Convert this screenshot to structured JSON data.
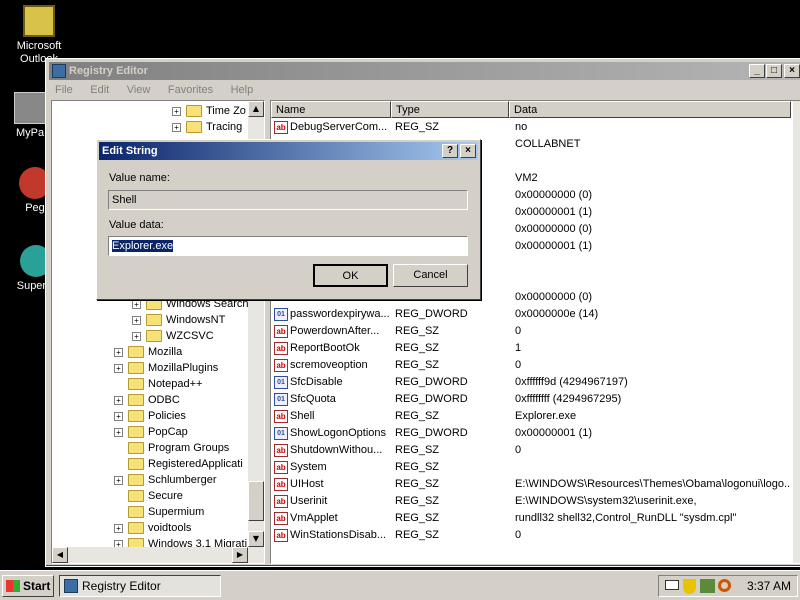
{
  "desktop": {
    "icons": [
      {
        "label": "Microsoft Outlook"
      },
      {
        "label": "MyPa"
      },
      {
        "label": "Peg"
      },
      {
        "label": "Superm"
      }
    ]
  },
  "window": {
    "title": "Registry Editor",
    "menu": [
      "File",
      "Edit",
      "View",
      "Favorites",
      "Help"
    ]
  },
  "tree": {
    "items": [
      {
        "label": "Time Zo",
        "expander": "+"
      },
      {
        "label": "Tracing",
        "expander": "+"
      },
      {
        "label": "Windows Search",
        "expander": "+"
      },
      {
        "label": "WindowsNT",
        "expander": "+"
      },
      {
        "label": "WZCSVC",
        "expander": "+"
      },
      {
        "label": "Mozilla",
        "expander": "+"
      },
      {
        "label": "MozillaPlugins",
        "expander": "+"
      },
      {
        "label": "Notepad++",
        "expander": ""
      },
      {
        "label": "ODBC",
        "expander": "+"
      },
      {
        "label": "Policies",
        "expander": "+"
      },
      {
        "label": "PopCap",
        "expander": "+"
      },
      {
        "label": "Program Groups",
        "expander": ""
      },
      {
        "label": "RegisteredApplicati",
        "expander": ""
      },
      {
        "label": "Schlumberger",
        "expander": "+"
      },
      {
        "label": "Secure",
        "expander": ""
      },
      {
        "label": "Supermium",
        "expander": ""
      },
      {
        "label": "voidtools",
        "expander": "+"
      },
      {
        "label": "Windows 3.1 Migrati",
        "expander": "+"
      }
    ]
  },
  "list": {
    "columns": [
      "Name",
      "Type",
      "Data"
    ],
    "top_rows": [
      {
        "name": "DebugServerCom...",
        "type": "REG_SZ",
        "data": "no",
        "icon": "string"
      },
      {
        "name": "",
        "type": "",
        "data": "COLLABNET",
        "icon": ""
      },
      {
        "name": "",
        "type": "",
        "data": "",
        "icon": ""
      },
      {
        "name": "",
        "type": "",
        "data": "VM2",
        "icon": ""
      },
      {
        "name": "",
        "type": "",
        "data": "0x00000000 (0)",
        "icon": ""
      },
      {
        "name": "",
        "type": "",
        "data": "0x00000001 (1)",
        "icon": ""
      },
      {
        "name": "",
        "type": "",
        "data": "0x00000000 (0)",
        "icon": ""
      },
      {
        "name": "",
        "type": "",
        "data": "0x00000001 (1)",
        "icon": ""
      },
      {
        "name": "",
        "type": "",
        "data": "",
        "icon": ""
      },
      {
        "name": "",
        "type": "",
        "data": "",
        "icon": ""
      },
      {
        "name": "",
        "type": "",
        "data": "0x00000000 (0)",
        "icon": ""
      }
    ],
    "rows": [
      {
        "name": "passwordexpirywa...",
        "type": "REG_DWORD",
        "data": "0x0000000e (14)",
        "icon": "binary"
      },
      {
        "name": "PowerdownAfter...",
        "type": "REG_SZ",
        "data": "0",
        "icon": "string"
      },
      {
        "name": "ReportBootOk",
        "type": "REG_SZ",
        "data": "1",
        "icon": "string"
      },
      {
        "name": "scremoveoption",
        "type": "REG_SZ",
        "data": "0",
        "icon": "string"
      },
      {
        "name": "SfcDisable",
        "type": "REG_DWORD",
        "data": "0xffffff9d (4294967197)",
        "icon": "binary"
      },
      {
        "name": "SfcQuota",
        "type": "REG_DWORD",
        "data": "0xffffffff (4294967295)",
        "icon": "binary"
      },
      {
        "name": "Shell",
        "type": "REG_SZ",
        "data": "Explorer.exe",
        "icon": "string"
      },
      {
        "name": "ShowLogonOptions",
        "type": "REG_DWORD",
        "data": "0x00000001 (1)",
        "icon": "binary"
      },
      {
        "name": "ShutdownWithou...",
        "type": "REG_SZ",
        "data": "0",
        "icon": "string"
      },
      {
        "name": "System",
        "type": "REG_SZ",
        "data": "",
        "icon": "string"
      },
      {
        "name": "UIHost",
        "type": "REG_SZ",
        "data": "E:\\WINDOWS\\Resources\\Themes\\Obama\\logonui\\logo...",
        "icon": "string"
      },
      {
        "name": "Userinit",
        "type": "REG_SZ",
        "data": "E:\\WINDOWS\\system32\\userinit.exe,",
        "icon": "string"
      },
      {
        "name": "VmApplet",
        "type": "REG_SZ",
        "data": "rundll32 shell32,Control_RunDLL \"sysdm.cpl\"",
        "icon": "string"
      },
      {
        "name": "WinStationsDisab...",
        "type": "REG_SZ",
        "data": "0",
        "icon": "string"
      }
    ]
  },
  "dialog": {
    "title": "Edit String",
    "help_label": "?",
    "close_label": "×",
    "value_name_label": "Value name:",
    "value_name": "Shell",
    "value_data_label": "Value data:",
    "value_data": "Explorer.exe",
    "ok_label": "OK",
    "cancel_label": "Cancel"
  },
  "taskbar": {
    "start_label": "Start",
    "task_label": "Registry Editor",
    "clock": "3:37 AM"
  }
}
